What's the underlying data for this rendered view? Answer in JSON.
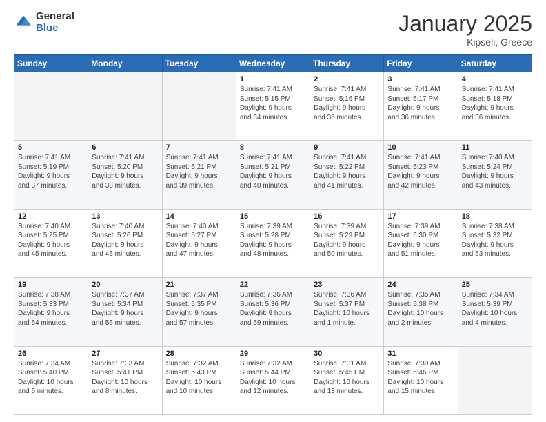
{
  "header": {
    "logo_general": "General",
    "logo_blue": "Blue",
    "month_year": "January 2025",
    "location": "Kipseli, Greece"
  },
  "days_of_week": [
    "Sunday",
    "Monday",
    "Tuesday",
    "Wednesday",
    "Thursday",
    "Friday",
    "Saturday"
  ],
  "weeks": [
    {
      "row_class": "row-odd",
      "days": [
        {
          "num": "",
          "info": "",
          "empty": true
        },
        {
          "num": "",
          "info": "",
          "empty": true
        },
        {
          "num": "",
          "info": "",
          "empty": true
        },
        {
          "num": "1",
          "info": "Sunrise: 7:41 AM\nSunset: 5:15 PM\nDaylight: 9 hours\nand 34 minutes.",
          "empty": false
        },
        {
          "num": "2",
          "info": "Sunrise: 7:41 AM\nSunset: 5:16 PM\nDaylight: 9 hours\nand 35 minutes.",
          "empty": false
        },
        {
          "num": "3",
          "info": "Sunrise: 7:41 AM\nSunset: 5:17 PM\nDaylight: 9 hours\nand 36 minutes.",
          "empty": false
        },
        {
          "num": "4",
          "info": "Sunrise: 7:41 AM\nSunset: 5:18 PM\nDaylight: 9 hours\nand 36 minutes.",
          "empty": false
        }
      ]
    },
    {
      "row_class": "row-even",
      "days": [
        {
          "num": "5",
          "info": "Sunrise: 7:41 AM\nSunset: 5:19 PM\nDaylight: 9 hours\nand 37 minutes.",
          "empty": false
        },
        {
          "num": "6",
          "info": "Sunrise: 7:41 AM\nSunset: 5:20 PM\nDaylight: 9 hours\nand 38 minutes.",
          "empty": false
        },
        {
          "num": "7",
          "info": "Sunrise: 7:41 AM\nSunset: 5:21 PM\nDaylight: 9 hours\nand 39 minutes.",
          "empty": false
        },
        {
          "num": "8",
          "info": "Sunrise: 7:41 AM\nSunset: 5:21 PM\nDaylight: 9 hours\nand 40 minutes.",
          "empty": false
        },
        {
          "num": "9",
          "info": "Sunrise: 7:41 AM\nSunset: 5:22 PM\nDaylight: 9 hours\nand 41 minutes.",
          "empty": false
        },
        {
          "num": "10",
          "info": "Sunrise: 7:41 AM\nSunset: 5:23 PM\nDaylight: 9 hours\nand 42 minutes.",
          "empty": false
        },
        {
          "num": "11",
          "info": "Sunrise: 7:40 AM\nSunset: 5:24 PM\nDaylight: 9 hours\nand 43 minutes.",
          "empty": false
        }
      ]
    },
    {
      "row_class": "row-odd",
      "days": [
        {
          "num": "12",
          "info": "Sunrise: 7:40 AM\nSunset: 5:25 PM\nDaylight: 9 hours\nand 45 minutes.",
          "empty": false
        },
        {
          "num": "13",
          "info": "Sunrise: 7:40 AM\nSunset: 5:26 PM\nDaylight: 9 hours\nand 46 minutes.",
          "empty": false
        },
        {
          "num": "14",
          "info": "Sunrise: 7:40 AM\nSunset: 5:27 PM\nDaylight: 9 hours\nand 47 minutes.",
          "empty": false
        },
        {
          "num": "15",
          "info": "Sunrise: 7:39 AM\nSunset: 5:28 PM\nDaylight: 9 hours\nand 48 minutes.",
          "empty": false
        },
        {
          "num": "16",
          "info": "Sunrise: 7:39 AM\nSunset: 5:29 PM\nDaylight: 9 hours\nand 50 minutes.",
          "empty": false
        },
        {
          "num": "17",
          "info": "Sunrise: 7:39 AM\nSunset: 5:30 PM\nDaylight: 9 hours\nand 51 minutes.",
          "empty": false
        },
        {
          "num": "18",
          "info": "Sunrise: 7:38 AM\nSunset: 5:32 PM\nDaylight: 9 hours\nand 53 minutes.",
          "empty": false
        }
      ]
    },
    {
      "row_class": "row-even",
      "days": [
        {
          "num": "19",
          "info": "Sunrise: 7:38 AM\nSunset: 5:33 PM\nDaylight: 9 hours\nand 54 minutes.",
          "empty": false
        },
        {
          "num": "20",
          "info": "Sunrise: 7:37 AM\nSunset: 5:34 PM\nDaylight: 9 hours\nand 56 minutes.",
          "empty": false
        },
        {
          "num": "21",
          "info": "Sunrise: 7:37 AM\nSunset: 5:35 PM\nDaylight: 9 hours\nand 57 minutes.",
          "empty": false
        },
        {
          "num": "22",
          "info": "Sunrise: 7:36 AM\nSunset: 5:36 PM\nDaylight: 9 hours\nand 59 minutes.",
          "empty": false
        },
        {
          "num": "23",
          "info": "Sunrise: 7:36 AM\nSunset: 5:37 PM\nDaylight: 10 hours\nand 1 minute.",
          "empty": false
        },
        {
          "num": "24",
          "info": "Sunrise: 7:35 AM\nSunset: 5:38 PM\nDaylight: 10 hours\nand 2 minutes.",
          "empty": false
        },
        {
          "num": "25",
          "info": "Sunrise: 7:34 AM\nSunset: 5:39 PM\nDaylight: 10 hours\nand 4 minutes.",
          "empty": false
        }
      ]
    },
    {
      "row_class": "row-odd",
      "days": [
        {
          "num": "26",
          "info": "Sunrise: 7:34 AM\nSunset: 5:40 PM\nDaylight: 10 hours\nand 6 minutes.",
          "empty": false
        },
        {
          "num": "27",
          "info": "Sunrise: 7:33 AM\nSunset: 5:41 PM\nDaylight: 10 hours\nand 8 minutes.",
          "empty": false
        },
        {
          "num": "28",
          "info": "Sunrise: 7:32 AM\nSunset: 5:43 PM\nDaylight: 10 hours\nand 10 minutes.",
          "empty": false
        },
        {
          "num": "29",
          "info": "Sunrise: 7:32 AM\nSunset: 5:44 PM\nDaylight: 10 hours\nand 12 minutes.",
          "empty": false
        },
        {
          "num": "30",
          "info": "Sunrise: 7:31 AM\nSunset: 5:45 PM\nDaylight: 10 hours\nand 13 minutes.",
          "empty": false
        },
        {
          "num": "31",
          "info": "Sunrise: 7:30 AM\nSunset: 5:46 PM\nDaylight: 10 hours\nand 15 minutes.",
          "empty": false
        },
        {
          "num": "",
          "info": "",
          "empty": true
        }
      ]
    }
  ]
}
